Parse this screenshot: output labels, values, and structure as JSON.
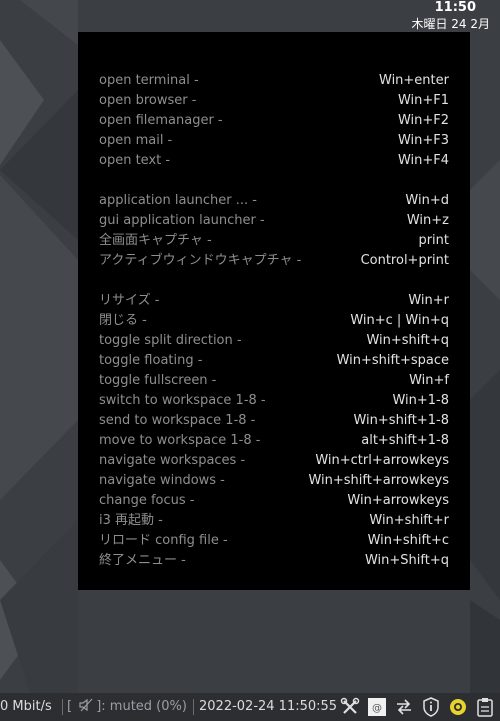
{
  "top_clock": {
    "time": "11:50",
    "date": "木曜日 24 2月"
  },
  "cheatsheet": {
    "groups": [
      [
        {
          "action": "open terminal -",
          "keys": "Win+enter"
        },
        {
          "action": "open browser -",
          "keys": "Win+F1"
        },
        {
          "action": "open filemanager -",
          "keys": "Win+F2"
        },
        {
          "action": "open mail -",
          "keys": "Win+F3"
        },
        {
          "action": "open text -",
          "keys": "Win+F4"
        }
      ],
      [
        {
          "action": "application launcher ... -",
          "keys": "Win+d"
        },
        {
          "action": "gui application launcher -",
          "keys": "Win+z"
        },
        {
          "action": "全画面キャプチャ -",
          "keys": "print"
        },
        {
          "action": "アクティブウィンドウキャプチャ -",
          "keys": "Control+print"
        }
      ],
      [
        {
          "action": "リサイズ -",
          "keys": "Win+r"
        },
        {
          "action": "閉じる -",
          "keys": "Win+c | Win+q"
        },
        {
          "action": "toggle split direction -",
          "keys": "Win+shift+q"
        },
        {
          "action": "toggle floating -",
          "keys": "Win+shift+space"
        },
        {
          "action": "toggle fullscreen -",
          "keys": "Win+f"
        },
        {
          "action": "switch to workspace 1-8 -",
          "keys": "Win+1-8"
        },
        {
          "action": "send to workspace 1-8 -",
          "keys": "Win+shift+1-8"
        },
        {
          "action": "move to workspace 1-8 -",
          "keys": "alt+shift+1-8"
        },
        {
          "action": "navigate workspaces -",
          "keys": "Win+ctrl+arrowkeys"
        },
        {
          "action": "navigate windows -",
          "keys": "Win+shift+arrowkeys"
        },
        {
          "action": "change focus -",
          "keys": "Win+arrowkeys"
        },
        {
          "action": "i3 再起動 -",
          "keys": "Win+shift+r"
        },
        {
          "action": "リロード config file -",
          "keys": "Win+shift+c"
        },
        {
          "action": "終了メニュー -",
          "keys": "Win+Shift+q"
        }
      ]
    ]
  },
  "statusbar": {
    "net": "0 Mbit/s",
    "volume_open": "[",
    "volume_close": "]: muted (0%)",
    "datetime": "2022-02-24 11:50:55",
    "tray_icons": [
      "tools-icon",
      "mail-icon",
      "network-transfer-icon",
      "info-shield-icon",
      "record-icon",
      "clipboard-icon"
    ]
  },
  "colors": {
    "panel_bg": "#000000",
    "action_text": "#8d8e90",
    "keys_text": "#e2e2e2",
    "bar_bg": "#2c2e32",
    "accent_yellow": "#e8d22c"
  }
}
